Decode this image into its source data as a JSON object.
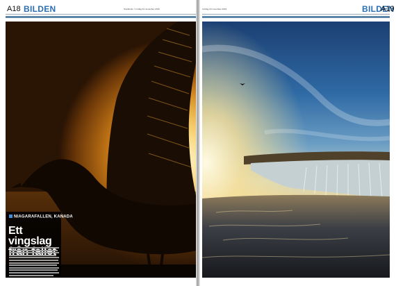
{
  "left_page": {
    "page_number": "A18",
    "section": "BILDEN",
    "header_small": "Stockholm / Lördag 23 november 2019"
  },
  "right_page": {
    "page_number": "A19",
    "section": "BILDEN",
    "header_small": "Lördag 23 november 2019"
  },
  "caption": {
    "kicker": "NIAGARAFALLEN, KANADA",
    "headline": "Ett vingslag från fallet"
  },
  "colors": {
    "section_blue": "#2a6fb3",
    "rule_blue": "#5b86a8",
    "kicker_square": "#3c8fd8"
  }
}
